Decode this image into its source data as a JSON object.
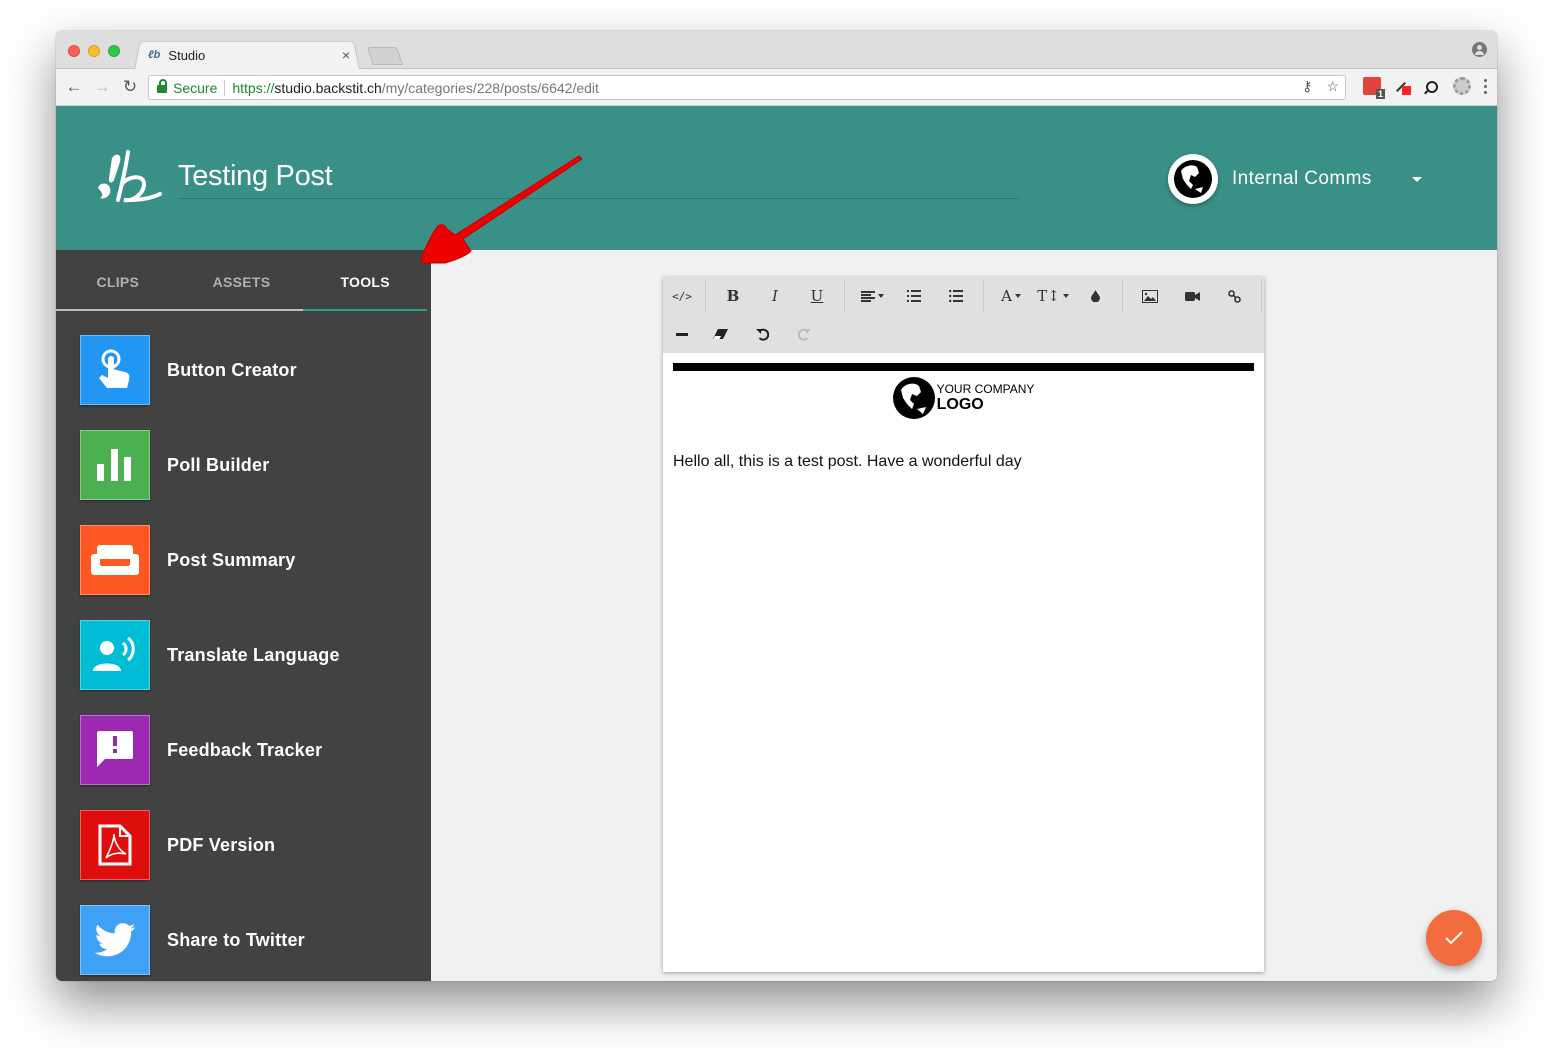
{
  "browser": {
    "tab_title": "Studio",
    "tab_favicon": "backstitch-logo-icon",
    "security_label": "Secure",
    "url_scheme": "https://",
    "url_host": "studio.backstit.ch",
    "url_path": "/my/categories/228/posts/6642/edit",
    "extension_badge": "1"
  },
  "header": {
    "title": "Testing Post",
    "org_name": "Internal Comms"
  },
  "sidebar": {
    "tabs": [
      {
        "label": "CLIPS",
        "active": false
      },
      {
        "label": "ASSETS",
        "active": false
      },
      {
        "label": "TOOLS",
        "active": true
      }
    ],
    "tools": [
      {
        "label": "Button Creator",
        "icon": "touch-icon",
        "color": "#2196f3"
      },
      {
        "label": "Poll Builder",
        "icon": "bar-chart-icon",
        "color": "#4caf50"
      },
      {
        "label": "Post Summary",
        "icon": "couch-icon",
        "color": "#ff5722"
      },
      {
        "label": "Translate Language",
        "icon": "speaker-person-icon",
        "color": "#00bcd4"
      },
      {
        "label": "Feedback Tracker",
        "icon": "feedback-icon",
        "color": "#9c27b0"
      },
      {
        "label": "PDF Version",
        "icon": "pdf-icon",
        "color": "#e00d0d"
      },
      {
        "label": "Share to Twitter",
        "icon": "twitter-icon",
        "color": "#3ea1f5"
      }
    ]
  },
  "editor": {
    "toolbar": {
      "code": "</>",
      "bold": "B",
      "italic": "I",
      "underline": "U",
      "font_color": "A",
      "font_size": "T↕"
    },
    "logo_top": "YOUR COMPANY",
    "logo_bottom": "LOGO",
    "body_text": "Hello all, this is a test post. Have a wonderful day"
  },
  "colors": {
    "header": "#389086",
    "sidebar": "#424242",
    "active_tab_underline": "#26a08f",
    "fab": "#f36c3f",
    "annotation_arrow": "#ee0000"
  }
}
